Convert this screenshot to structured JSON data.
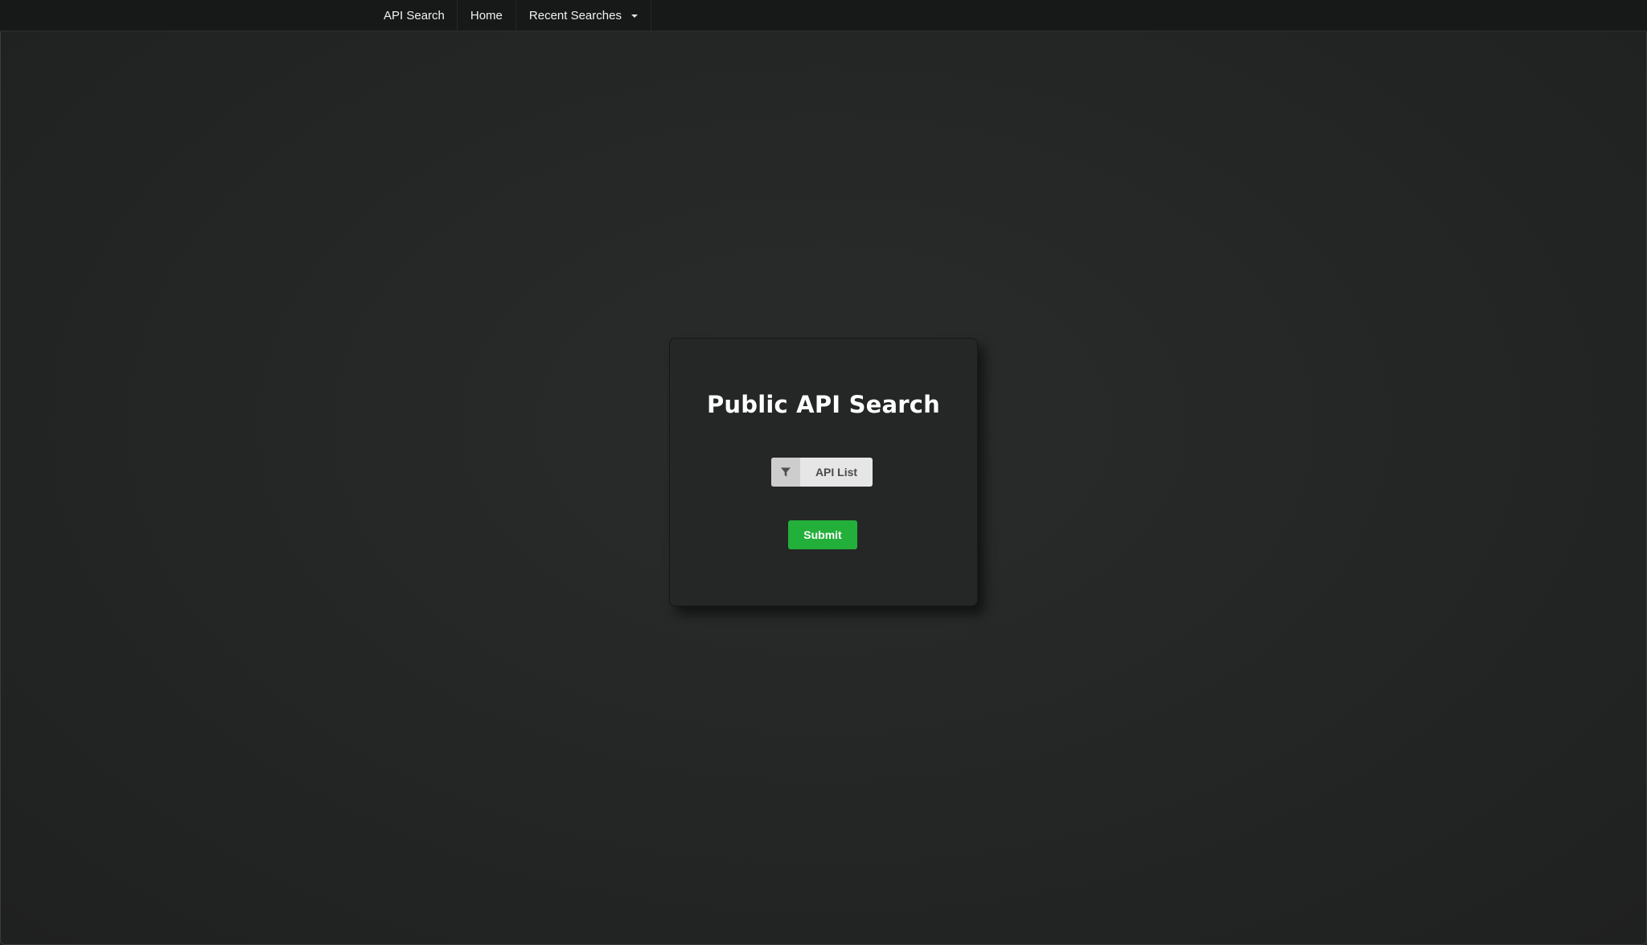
{
  "navbar": {
    "brand": "API Search",
    "items": [
      {
        "label": "Home"
      },
      {
        "label": "Recent Searches",
        "has_dropdown": true
      }
    ]
  },
  "card": {
    "title": "Public API Search",
    "filter_button": {
      "label": "API List",
      "icon": "filter-icon"
    },
    "submit_button": {
      "label": "Submit"
    }
  },
  "colors": {
    "background": "#252727",
    "navbar": "#171818",
    "submit": "#22b03a",
    "filter_button": "#e6e6e6"
  }
}
